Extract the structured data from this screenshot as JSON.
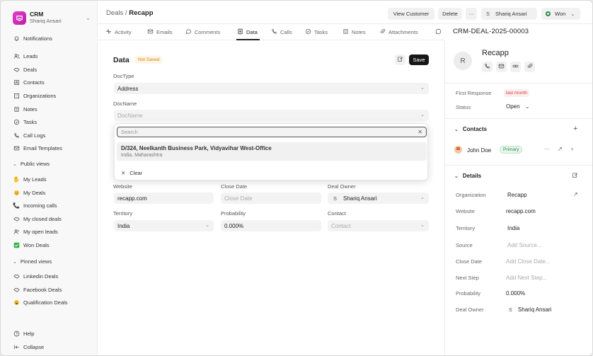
{
  "app": {
    "name": "CRM",
    "user": "Shariq Ansari"
  },
  "sidebar": {
    "top": [
      {
        "label": "Notifications",
        "icon": "bell-icon"
      }
    ],
    "main": [
      {
        "label": "Leads",
        "icon": "users-icon"
      },
      {
        "label": "Deals",
        "icon": "handshake-icon"
      },
      {
        "label": "Contacts",
        "icon": "contact-icon"
      },
      {
        "label": "Organizations",
        "icon": "building-icon"
      },
      {
        "label": "Notes",
        "icon": "note-icon"
      },
      {
        "label": "Tasks",
        "icon": "check-circle-icon"
      },
      {
        "label": "Call Logs",
        "icon": "phone-icon"
      },
      {
        "label": "Email Templates",
        "icon": "mail-icon"
      }
    ],
    "public_views_label": "Public views",
    "public_views": [
      {
        "label": "My Leads",
        "icon": "hand-emoji-icon"
      },
      {
        "label": "My Deals",
        "icon": "smile-emoji-icon"
      },
      {
        "label": "Incoming calls",
        "icon": "phone-emoji-icon"
      },
      {
        "label": "My closed deals",
        "icon": "handshake-icon"
      },
      {
        "label": "My open leads",
        "icon": "users-icon"
      },
      {
        "label": "Won Deals",
        "icon": "check-emoji-icon"
      }
    ],
    "pinned_views_label": "Pinned views",
    "pinned_views": [
      {
        "label": "Linkedin Deals",
        "icon": "handshake-icon"
      },
      {
        "label": "Facebook Deals",
        "icon": "handshake-icon"
      },
      {
        "label": "Qualification Deals",
        "icon": "grin-emoji-icon"
      }
    ],
    "help": "Help",
    "collapse": "Collapse"
  },
  "header": {
    "breadcrumb_parent": "Deals",
    "breadcrumb_sep": " / ",
    "breadcrumb_current": "Recapp",
    "view_customer": "View Customer",
    "delete": "Delete",
    "more": "···",
    "assignee_initial": "S",
    "assignee": "Shariq Ansari",
    "status": "Won",
    "status_color": "#2c8a4b"
  },
  "tabs": [
    {
      "label": "Activity",
      "icon": "activity-icon"
    },
    {
      "label": "Emails",
      "icon": "mail-icon"
    },
    {
      "label": "Comments",
      "icon": "comment-icon"
    },
    {
      "label": "Data",
      "icon": "data-icon",
      "active": true
    },
    {
      "label": "Calls",
      "icon": "phone-icon"
    },
    {
      "label": "Tasks",
      "icon": "check-circle-icon"
    },
    {
      "label": "Notes",
      "icon": "note-icon"
    },
    {
      "label": "Attachments",
      "icon": "paperclip-icon"
    },
    {
      "label": "",
      "icon": "whatsapp-icon"
    }
  ],
  "deal_id": "CRM-DEAL-2025-00003",
  "data_panel": {
    "title": "Data",
    "status_badge": "Not Saved",
    "save": "Save",
    "doctype_label": "DocType",
    "doctype_value": "Address",
    "docname_label": "DocName",
    "docname_placeholder": "DocName",
    "website_label": "Website",
    "website_value": "recapp.com",
    "close_date_label": "Close Date",
    "close_date_placeholder": "Close Date",
    "deal_owner_label": "Deal Owner",
    "deal_owner_initial": "S",
    "deal_owner_value": "Shariq Ansari",
    "territory_label": "Territory",
    "territory_value": "India",
    "probability_label": "Probability",
    "probability_value": "0.000%",
    "contact_label": "Contact",
    "contact_placeholder": "Contact"
  },
  "dropdown": {
    "search_placeholder": "Search",
    "option_title": "D/324, Neelkanth Business Park, Vidyavihar West-Office",
    "option_subtitle": "India, Maharashtra",
    "clear": "Clear"
  },
  "right_panel": {
    "avatar_initial": "R",
    "name": "Recapp",
    "first_response_label": "First Response",
    "first_response_value": "last month",
    "status_label": "Status",
    "status_value": "Open",
    "contacts_label": "Contacts",
    "contact_name": "John Doe",
    "contact_badge": "Primary",
    "details_label": "Details",
    "details": [
      {
        "label": "Organization",
        "value": "Recapp",
        "muted": false
      },
      {
        "label": "Website",
        "value": "recapp.com",
        "muted": false
      },
      {
        "label": "Territory",
        "value": "India",
        "muted": false
      },
      {
        "label": "Source",
        "value": "Add Source...",
        "muted": true
      },
      {
        "label": "Close Date",
        "value": "Add Close Date...",
        "muted": true
      },
      {
        "label": "Next Step",
        "value": "Add Next Step...",
        "muted": true
      },
      {
        "label": "Probability",
        "value": "0.000%",
        "muted": false
      },
      {
        "label": "Deal Owner",
        "value": "Shariq Ansari",
        "muted": false,
        "initial": "S"
      }
    ]
  }
}
